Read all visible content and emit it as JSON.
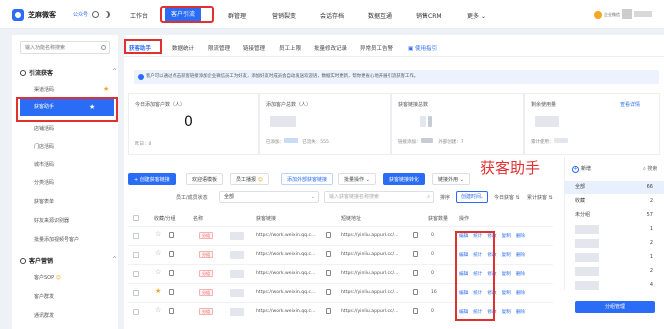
{
  "brand": {
    "name": "芝麻微客",
    "tag": "公众号"
  },
  "nav": {
    "items": [
      "工作台",
      "客户引流",
      "群管理",
      "营销裂变",
      "会话存档",
      "数据互通",
      "销售CRM",
      "更多"
    ],
    "active": "客户引流",
    "more_caret": "⌄"
  },
  "account": {
    "badge": "企业微信"
  },
  "sidebar": {
    "search_placeholder": "输入功能名称搜索",
    "group1": {
      "label": "引流获客",
      "chevron": "^"
    },
    "items1": [
      "渠道活码",
      "获客助手",
      "店铺活码",
      "门店活码",
      "城市活码",
      "分类活码",
      "获客表单",
      "好友来源识别器",
      "批量添加视频号客户"
    ],
    "active_item": "获客助手",
    "group2": {
      "label": "客户营销",
      "chevron": "^"
    },
    "items2": [
      "客户SOP",
      "客户群发",
      "通讯群发"
    ],
    "sop_emoji": "😊"
  },
  "tabs": {
    "items": [
      "获客助手",
      "数据统计",
      "限流管理",
      "链接管理",
      "员工上限",
      "批量修改记录",
      "异常员工告警"
    ],
    "help": "使用指引"
  },
  "notice": "客户可以通过点击获客链接添加企业微信员工为好友，添加好友时成员会自动发送欢迎语，数据实时更新，帮你更省心地开展引流获客工作。",
  "stats": {
    "today": {
      "label": "今日添加客户数（人）",
      "value": "0",
      "sub": "昨日：0"
    },
    "total": {
      "label": "添加客户总数（人）",
      "sub1": "已添加：",
      "sub2": "已流失：555"
    },
    "link": {
      "label": "获客链接总数",
      "sub1": "链接添加：",
      "sub2": "外部创建：7"
    },
    "remain": {
      "label": "剩余使用量",
      "link": "查看详情",
      "sub": "累计使用："
    }
  },
  "toolbar": {
    "create": "+ 创建获客链接",
    "welcome": "欢迎语模板",
    "staff": "员工播报",
    "add_external": "添加外部获客链接",
    "batch": "批量操作",
    "convert": "获客链接转化",
    "qrcode": "链接外用"
  },
  "filters": {
    "staff_label": "员工/成员状态",
    "staff_value": "全部",
    "search_placeholder": "输入获客链接名称搜索",
    "sort_label": "排序",
    "sort_value": "创建时间",
    "today_label": "今日获客",
    "total_label": "累计获客"
  },
  "table": {
    "headers": [
      "收藏/分组",
      "名称",
      "获客链接",
      "短链地址",
      "获客数量",
      "操作"
    ],
    "rows": [
      {
        "starred": false,
        "tag": "分组",
        "link": "https://work.weixin.qq.c...",
        "short": "https://yinliu.appurl.cc/...",
        "count": "0"
      },
      {
        "starred": false,
        "tag": "分组",
        "link": "https://work.weixin.qq.c...",
        "short": "https://yinliu.appurl.cc/...",
        "count": "0"
      },
      {
        "starred": false,
        "tag": "分组",
        "link": "https://work.weixin.qq.c...",
        "short": "https://yinliu.appurl.cc/...",
        "count": "0"
      },
      {
        "starred": true,
        "tag": "分组",
        "link": "https://work.weixin.qq.c...",
        "short": "https://yinliu.appurl.cc/...",
        "count": "16"
      },
      {
        "starred": false,
        "tag": "分组",
        "link": "https://work.weixin.qq.c...",
        "short": "https://yinliu.appurl.cc/...",
        "count": "0"
      }
    ],
    "ops": [
      "编辑",
      "统计",
      "修改",
      "复制",
      "删除"
    ]
  },
  "overlay_label": "获客助手",
  "right_panel": {
    "add": "新增",
    "search": "搜索",
    "groups": [
      {
        "name": "全部",
        "count": "66"
      },
      {
        "name": "收藏",
        "count": "2"
      },
      {
        "name": "未分组",
        "count": "57"
      }
    ],
    "counts": [
      "1",
      "2",
      "1",
      "2",
      "4"
    ],
    "button": "分组管理"
  },
  "colors": {
    "primary": "#2a6cf6",
    "highlight": "#e03030",
    "star": "#f5a623"
  }
}
